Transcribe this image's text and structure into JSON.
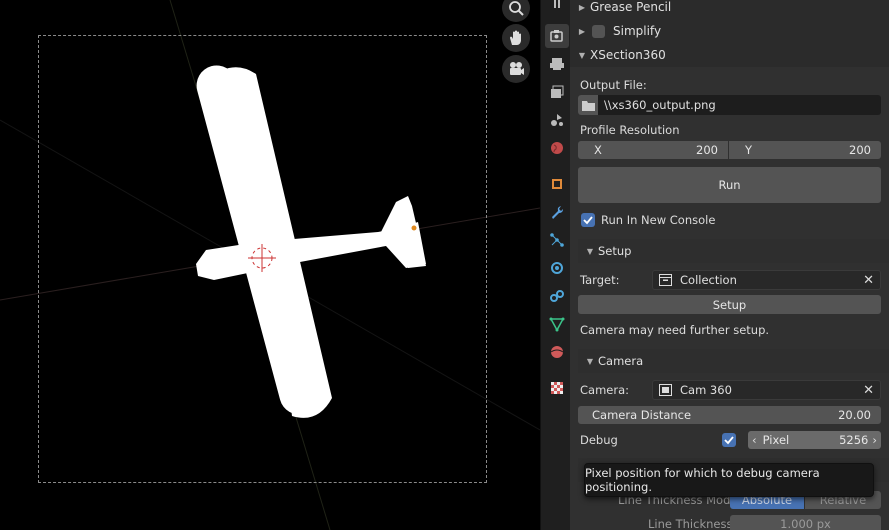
{
  "panel": {
    "sections": {
      "grease_pencil": "Grease Pencil",
      "simplify": "Simplify",
      "xsection": "XSection360"
    },
    "output_file": {
      "label": "Output File:",
      "value": "\\\\xs360_output.png"
    },
    "profile_resolution": {
      "label": "Profile Resolution",
      "x_label": "X",
      "x_value": "200",
      "y_label": "Y",
      "y_value": "200"
    },
    "run_button": "Run",
    "run_new_console": "Run In New Console",
    "setup": {
      "header": "Setup",
      "target_label": "Target:",
      "target_value": "Collection",
      "setup_button": "Setup",
      "note": "Camera may need further setup."
    },
    "camera": {
      "header": "Camera",
      "camera_label": "Camera:",
      "camera_value": "Cam 360",
      "distance_label": "Camera Distance",
      "distance_value": "20.00",
      "debug_label": "Debug",
      "pixel_label": "Pixel",
      "pixel_value": "5256"
    },
    "thickness": {
      "mode_label": "Line Thickness Mode",
      "mode_absolute": "Absolute",
      "mode_relative": "Relative",
      "thickness_label": "Line Thickness",
      "thickness_value": "1.000 px"
    },
    "tooltip": "Pixel position for which to debug camera positioning."
  },
  "colors": {
    "accent": "#4772b3",
    "panel_bg": "#303030",
    "field_bg": "#1d1d1d",
    "button_bg": "#545454"
  },
  "icons": [
    "zoom-icon",
    "hand-icon",
    "camera-view-icon",
    "render-icon",
    "output-icon",
    "view-layer-icon",
    "scene-icon",
    "world-icon",
    "object-icon",
    "modifier-icon",
    "particles-icon",
    "physics-icon",
    "constraints-icon",
    "data-icon",
    "material-icon",
    "texture-icon"
  ]
}
